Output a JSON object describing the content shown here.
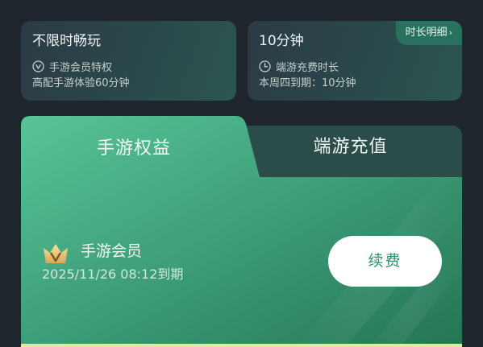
{
  "top_cards": {
    "left": {
      "title": "不限时畅玩",
      "badge_text": "手游会员特权",
      "desc": "高配手游体验60分钟"
    },
    "right": {
      "title": "10分钟",
      "detail_link": "时长明细",
      "badge_text": "端游充费时长",
      "desc": "本周四到期：10分钟"
    }
  },
  "tabs": {
    "active": "手游权益",
    "inactive": "端游充值"
  },
  "member": {
    "name": "手游会员",
    "expire": "2025/11/26 08:12到期",
    "renew_label": "续费"
  },
  "colors": {
    "background": "#1e252d",
    "panel_green": "#3f9e7b",
    "accent": "#27715f",
    "button_text": "#2e8f6b"
  }
}
